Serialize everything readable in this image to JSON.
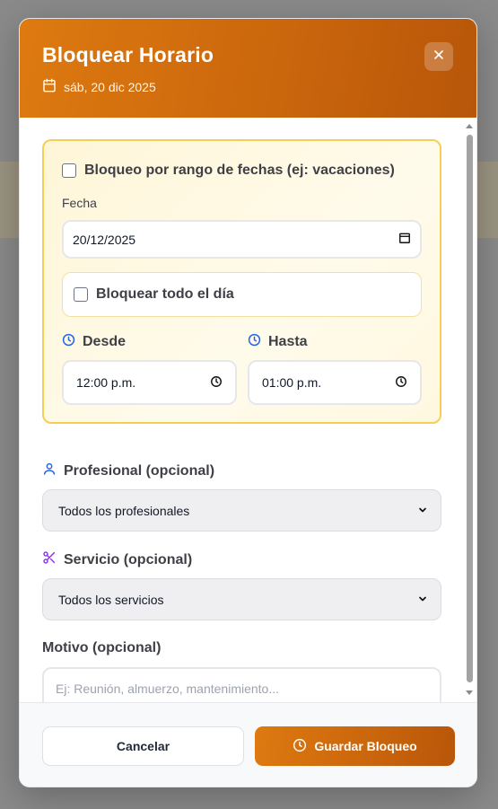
{
  "modal": {
    "title": "Bloquear Horario",
    "date": "sáb, 20 dic 2025"
  },
  "form": {
    "range_checkbox_label": "Bloqueo por rango de fechas (ej: vacaciones)",
    "date_label": "Fecha",
    "date_value": "20/12/2025",
    "allday_label": "Bloquear todo el día",
    "from_label": "Desde",
    "from_value": "12:00 p.m.",
    "to_label": "Hasta",
    "to_value": "01:00 p.m.",
    "professional_label": "Profesional (opcional)",
    "professional_value": "Todos los profesionales",
    "service_label": "Servicio (opcional)",
    "service_value": "Todos los servicios",
    "reason_label": "Motivo (opcional)",
    "reason_placeholder": "Ej: Reunión, almuerzo, mantenimiento..."
  },
  "footer": {
    "cancel_label": "Cancelar",
    "save_label": "Guardar Bloqueo"
  },
  "colors": {
    "accent": "#d9730f",
    "panel_border": "#f5cf55",
    "icon_blue": "#2563eb",
    "icon_purple": "#9333ea"
  }
}
